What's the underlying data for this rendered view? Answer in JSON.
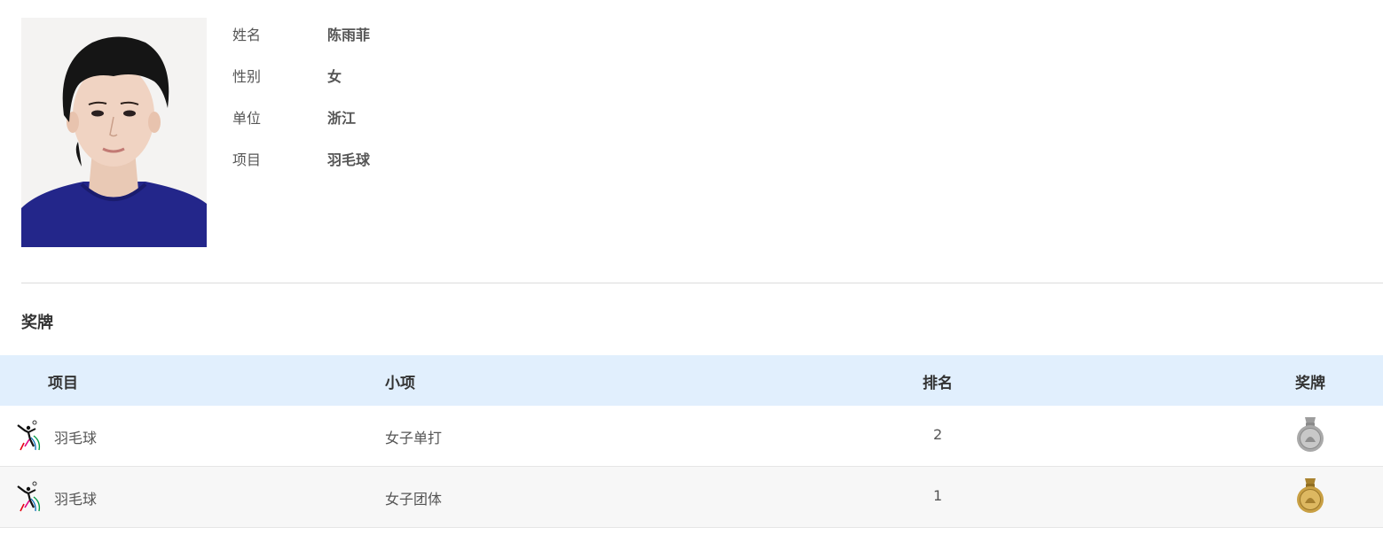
{
  "profile": {
    "fields": [
      {
        "label": "姓名",
        "value": "陈雨菲"
      },
      {
        "label": "性别",
        "value": "女"
      },
      {
        "label": "单位",
        "value": "浙江"
      },
      {
        "label": "项目",
        "value": "羽毛球"
      }
    ]
  },
  "medals_section": {
    "title": "奖牌",
    "columns": {
      "project": "项目",
      "event": "小项",
      "rank": "排名",
      "medal": "奖牌"
    },
    "rows": [
      {
        "project": "羽毛球",
        "event": "女子单打",
        "rank": "2",
        "medal": "silver-medal-icon",
        "medal_color": "#a9a9a9"
      },
      {
        "project": "羽毛球",
        "event": "女子团体",
        "rank": "1",
        "medal": "gold-medal-icon",
        "medal_color": "#c9a044"
      }
    ]
  },
  "colors": {
    "header_bg": "#e1effd",
    "alt_row_bg": "#f7f7f7",
    "shirt": "#23268a"
  }
}
